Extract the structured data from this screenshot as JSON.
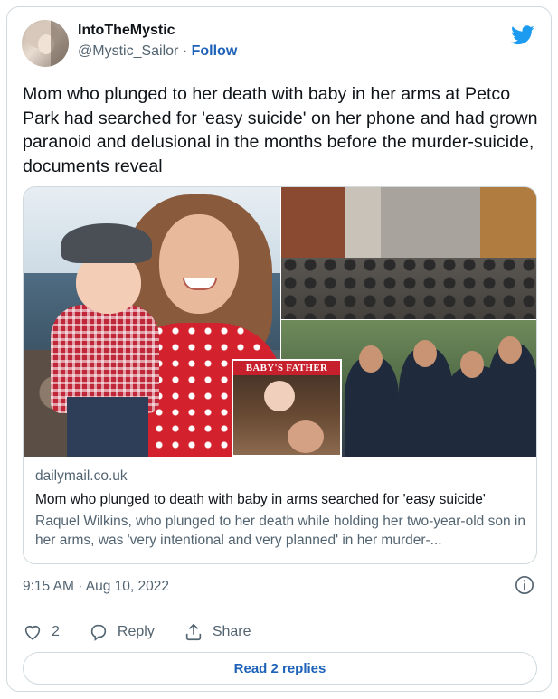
{
  "author": {
    "display_name": "IntoTheMystic",
    "handle": "@Mystic_Sailor",
    "separator": "·",
    "follow_label": "Follow"
  },
  "tweet": {
    "text": "Mom who plunged to her death with baby in her arms at Petco Park had searched for 'easy suicide' on her phone and had grown paranoid and delusional in the months before the murder-suicide, documents reveal"
  },
  "link_card": {
    "inset_label": "BABY'S FATHER",
    "domain": "dailymail.co.uk",
    "title": "Mom who plunged to death with baby in arms searched for 'easy suicide'",
    "description": "Raquel Wilkins, who plunged to her death while holding her two-year-old son in her arms, was 'very intentional and very planned' in her murder-..."
  },
  "meta": {
    "timestamp": "9:15 AM · Aug 10, 2022"
  },
  "actions": {
    "like_count": "2",
    "reply_label": "Reply",
    "share_label": "Share"
  },
  "read_replies_label": "Read 2 replies",
  "colors": {
    "twitter_blue": "#1d9bf0",
    "link_blue": "#1d62b8",
    "secondary_text": "#536471",
    "border": "#cfd9de"
  },
  "icons": [
    "twitter-bird-icon",
    "info-icon",
    "heart-icon",
    "reply-icon",
    "share-icon"
  ]
}
